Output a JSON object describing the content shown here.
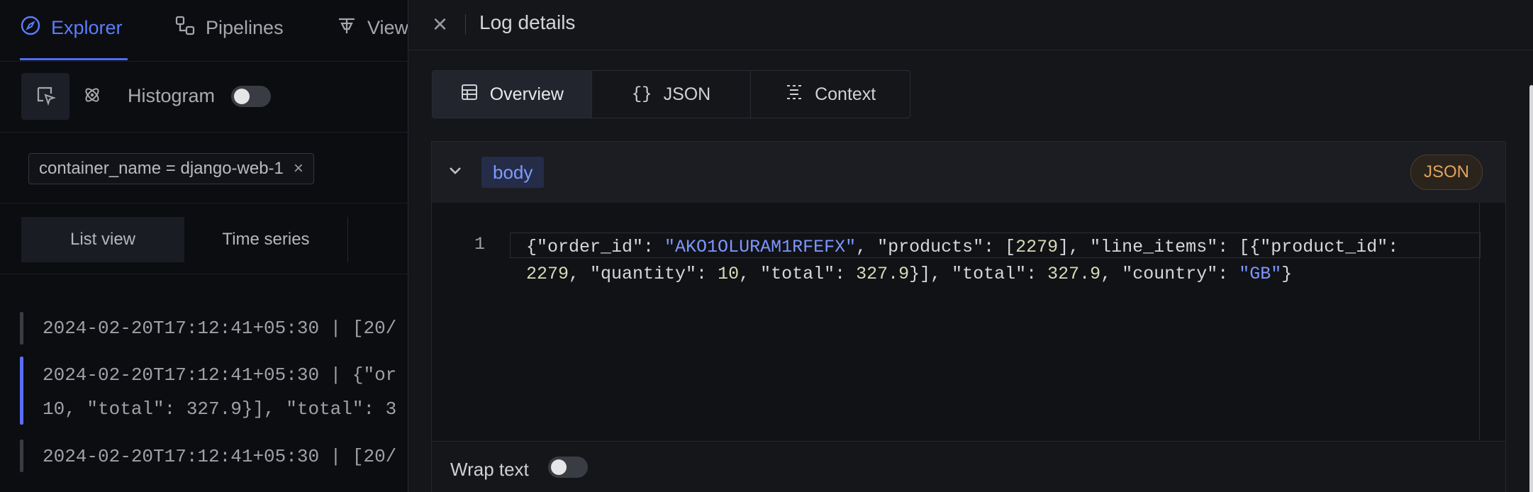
{
  "nav": {
    "tabs": [
      {
        "label": "Explorer",
        "icon": "compass-icon"
      },
      {
        "label": "Pipelines",
        "icon": "pipeline-icon"
      },
      {
        "label": "Views",
        "icon": "views-icon"
      }
    ]
  },
  "toolbar": {
    "histogram_label": "Histogram",
    "histogram_enabled": false
  },
  "filter": {
    "chip_label": "container_name = django-web-1",
    "remove_glyph": "×"
  },
  "view_tabs": [
    "List view",
    "Time series"
  ],
  "logs": [
    {
      "line1": "2024-02-20T17:12:41+05:30 | [20/",
      "line2": ""
    },
    {
      "line1": "2024-02-20T17:12:41+05:30 | {\"or",
      "line2": "10, \"total\": 327.9}], \"total\": 3"
    },
    {
      "line1": "2024-02-20T17:12:41+05:30 | [20/",
      "line2": ""
    }
  ],
  "drawer": {
    "title": "Log details",
    "close_glyph": "×",
    "tabs": [
      {
        "label": "Overview",
        "icon": "table-icon",
        "active": true
      },
      {
        "label": "JSON",
        "icon": "braces-icon",
        "active": false
      },
      {
        "label": "Context",
        "icon": "context-icon",
        "active": false
      }
    ],
    "field": {
      "name": "body",
      "badge": "JSON",
      "line_number": "1"
    },
    "wrap_text_label": "Wrap text",
    "wrap_text_enabled": false
  },
  "colors": {
    "accent": "#5b7cff",
    "json_badge": "#e2a25e",
    "string_token": "#7c96ff"
  }
}
